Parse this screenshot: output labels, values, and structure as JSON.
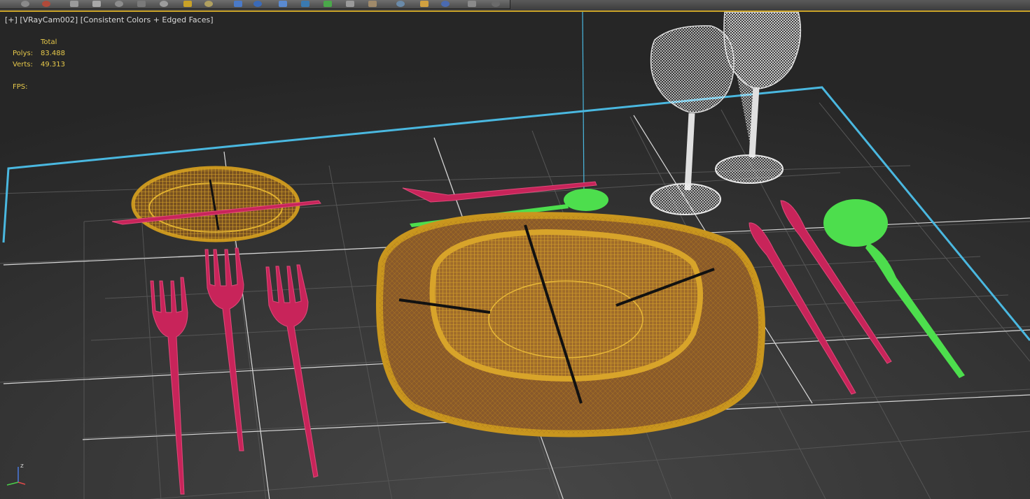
{
  "viewport": {
    "label_plus": "[+]",
    "label_camera": "[VRayCam002]",
    "label_shading": "[Consistent Colors + Edged Faces]",
    "stats": {
      "header": "Total",
      "polys_label": "Polys:",
      "polys_value": "83.488",
      "verts_label": "Verts:",
      "verts_value": "49.313",
      "fps_label": "FPS:"
    },
    "axis_label": "z",
    "colors": {
      "grid": "#4a4a4a",
      "grid_major": "#e0e0e0",
      "plate": "#c9961e",
      "plate_fill": "#8a5a2a",
      "cutlery": "#c8245a",
      "spoon": "#4dde4d",
      "glass": "#e8e8e8",
      "selection": "#4ab8e0"
    }
  },
  "toolbar": {
    "icons": [
      "undo-icon",
      "redo-icon",
      "link-icon",
      "unlink-icon",
      "bind-icon",
      "select-icon",
      "select-region-icon",
      "move-icon",
      "rotate-icon",
      "scale-icon",
      "snap-icon",
      "angle-snap-icon",
      "percent-snap-icon",
      "mirror-icon",
      "align-icon",
      "layer-icon",
      "curve-editor-icon",
      "material-icon",
      "render-setup-icon",
      "render-icon",
      "teapot-icon"
    ]
  }
}
